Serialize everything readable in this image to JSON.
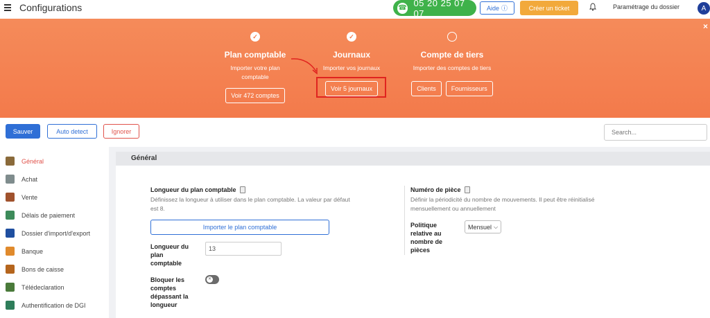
{
  "topbar": {
    "title": "Configurations",
    "phone": "05 20 25 07 07",
    "help_label": "Aide",
    "ticket_label": "Créer un ticket",
    "settings_label": "Paramétrage du dossier",
    "avatar_initial": "A"
  },
  "banner": {
    "close": "×",
    "steps": [
      {
        "title": "Plan comptable",
        "desc_line1": "Importer votre plan",
        "desc_line2": "comptable",
        "button": "Voir 472 comptes",
        "done": true
      },
      {
        "title": "Journaux",
        "desc_line1": "Importer vos journaux",
        "button": "Voir 5 journaux",
        "done": true
      },
      {
        "title": "Compte de tiers",
        "desc_line1": "Importer des comptes de tiers",
        "buttons": [
          "Clients",
          "Fournisseurs"
        ],
        "done": false
      }
    ]
  },
  "toolbar": {
    "save_label": "Sauver",
    "auto_label": "Auto detect",
    "ignore_label": "Ignorer",
    "search_placeholder": "Search..."
  },
  "sidebar": {
    "items": [
      {
        "label": "Général",
        "icon": "gear-icon",
        "active": true
      },
      {
        "label": "Achat",
        "icon": "cart-icon"
      },
      {
        "label": "Vente",
        "icon": "chart-icon"
      },
      {
        "label": "Délais de paiement",
        "icon": "calendar-icon"
      },
      {
        "label": "Dossier d'import/d'export",
        "icon": "folder-icon"
      },
      {
        "label": "Banque",
        "icon": "bank-icon"
      },
      {
        "label": "Bons de caisse",
        "icon": "receipt-icon"
      },
      {
        "label": "Télédeclaration",
        "icon": "declaration-icon"
      },
      {
        "label": "Authentification de DGI",
        "icon": "auth-icon"
      }
    ]
  },
  "main": {
    "header": "Général",
    "plan": {
      "title": "Longueur du plan comptable",
      "desc_line1": "Définissez la longueur à utiliser dans le plan comptable. La valeur par défaut",
      "desc_line2": "est 8.",
      "import_button": "Importer le plan comptable",
      "length_label": [
        "Longueur du",
        "plan",
        "comptable"
      ],
      "length_value": "13",
      "block_label": [
        "Bloquer les",
        "comptes",
        "dépassant la",
        "longueur"
      ]
    },
    "piece": {
      "title": "Numéro de pièce",
      "desc_line1": "Définir la périodicité du nombre de mouvements. Il peut être réinitialisé",
      "desc_line2": "mensuellement ou annuellement",
      "policy_label": [
        "Politique",
        "relative au",
        "nombre de",
        "pièces"
      ],
      "policy_value": "Mensuel"
    }
  },
  "colors": {
    "accent": "#2f6fd6",
    "banner": "#f37a4b",
    "phone": "#3fb24a",
    "ticket": "#f2a93b",
    "annotation": "#e0241f"
  }
}
